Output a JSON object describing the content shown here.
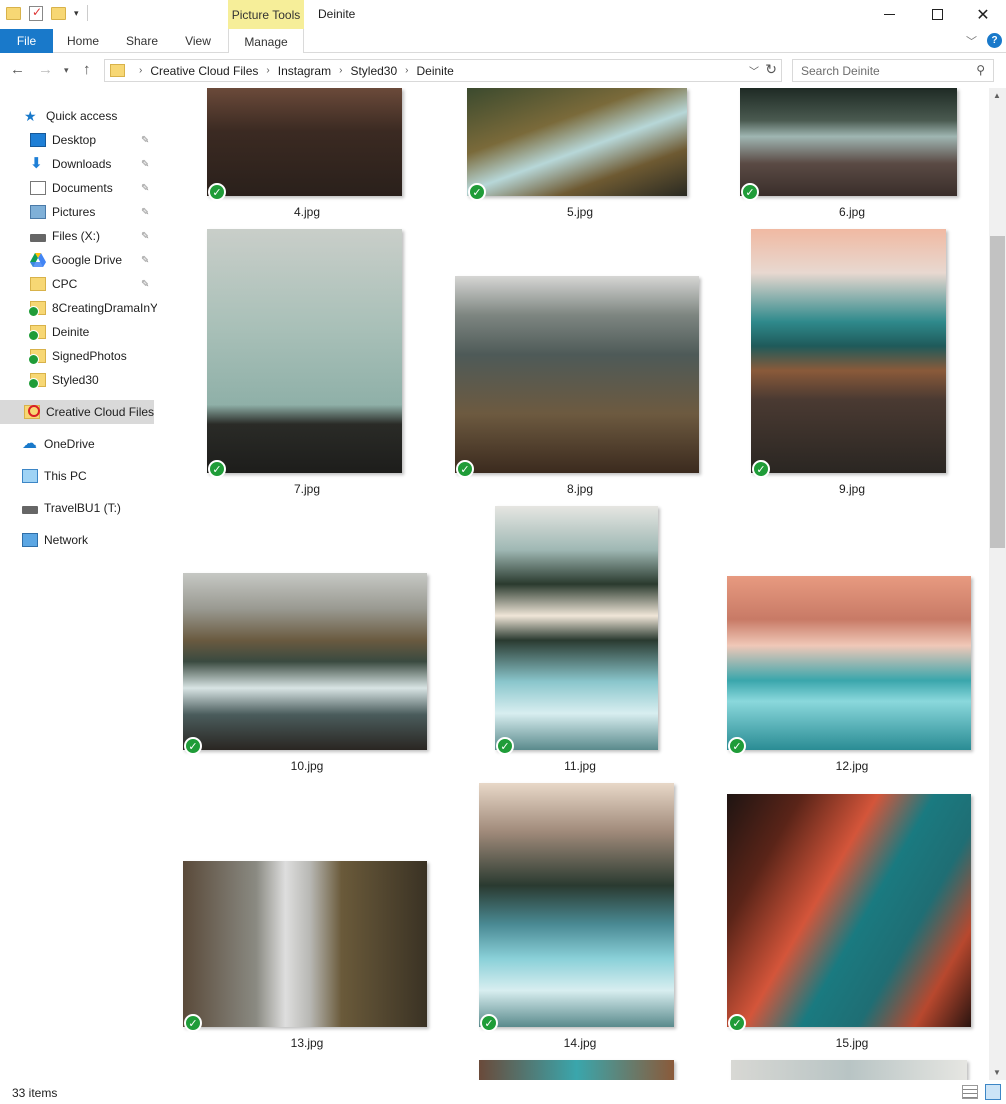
{
  "titlebar": {
    "contextual_tab": "Picture Tools",
    "window_title": "Deinite",
    "close_glyph": "✕"
  },
  "ribbon": {
    "tabs": [
      "File",
      "Home",
      "Share",
      "View",
      "Manage"
    ],
    "help": "?"
  },
  "address": {
    "crumbs": [
      "Creative Cloud Files",
      "Instagram",
      "Styled30",
      "Deinite"
    ],
    "search_placeholder": "Search Deinite"
  },
  "navpane": {
    "items": [
      {
        "label": "Quick access",
        "icon": "star-icon"
      },
      {
        "label": "Desktop",
        "icon": "desktop-icon",
        "pinned": true
      },
      {
        "label": "Downloads",
        "icon": "download-icon",
        "pinned": true
      },
      {
        "label": "Documents",
        "icon": "documents-icon",
        "pinned": true
      },
      {
        "label": "Pictures",
        "icon": "pictures-icon",
        "pinned": true
      },
      {
        "label": "Files (X:)",
        "icon": "drive-icon",
        "pinned": true
      },
      {
        "label": "Google Drive",
        "icon": "google-drive-icon",
        "pinned": true
      },
      {
        "label": "CPC",
        "icon": "folder-icon",
        "pinned": true
      },
      {
        "label": "8CreatingDramaInY",
        "icon": "synced-folder-icon"
      },
      {
        "label": "Deinite",
        "icon": "synced-folder-icon"
      },
      {
        "label": "SignedPhotos",
        "icon": "synced-folder-icon"
      },
      {
        "label": "Styled30",
        "icon": "synced-folder-icon"
      },
      {
        "label": "Creative Cloud Files",
        "icon": "creative-cloud-icon",
        "selected": true
      },
      {
        "label": "OneDrive",
        "icon": "onedrive-icon"
      },
      {
        "label": "This PC",
        "icon": "this-pc-icon"
      },
      {
        "label": "TravelBU1 (T:)",
        "icon": "drive-icon"
      },
      {
        "label": "Network",
        "icon": "network-icon"
      }
    ]
  },
  "files": [
    {
      "name": "4.jpg",
      "status": "synced"
    },
    {
      "name": "5.jpg",
      "status": "synced"
    },
    {
      "name": "6.jpg",
      "status": "synced"
    },
    {
      "name": "7.jpg",
      "status": "synced"
    },
    {
      "name": "8.jpg",
      "status": "synced"
    },
    {
      "name": "9.jpg",
      "status": "synced"
    },
    {
      "name": "10.jpg",
      "status": "synced"
    },
    {
      "name": "11.jpg",
      "status": "synced"
    },
    {
      "name": "12.jpg",
      "status": "synced"
    },
    {
      "name": "13.jpg",
      "status": "synced"
    },
    {
      "name": "14.jpg",
      "status": "synced"
    },
    {
      "name": "15.jpg",
      "status": "synced"
    }
  ],
  "status": {
    "item_count": "33 items"
  },
  "colors": {
    "accent": "#1979ca",
    "sync_check": "#1f9c38",
    "contextual_tab": "#f6ee99"
  }
}
